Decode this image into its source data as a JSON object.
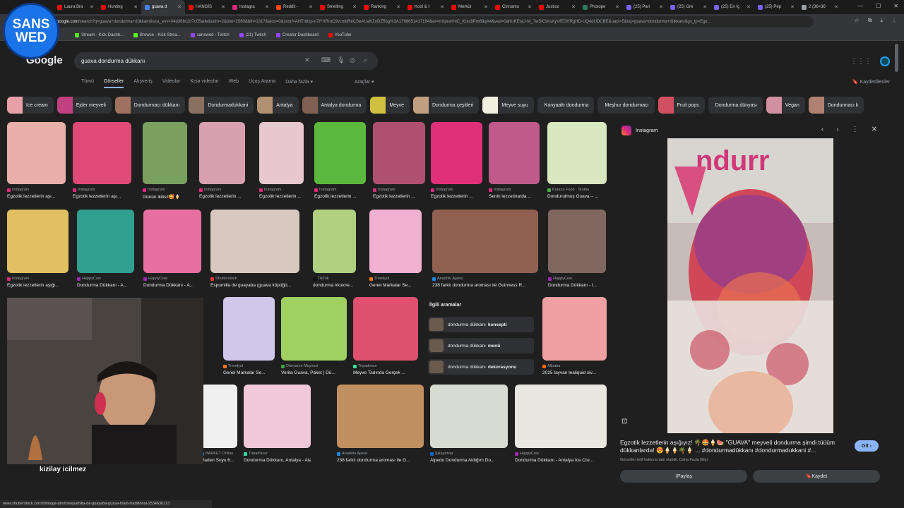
{
  "tabs": [
    {
      "label": "Laura Bra",
      "color": "#ff0000",
      "active": false
    },
    {
      "label": "Hunting",
      "color": "#ff0000",
      "active": false
    },
    {
      "label": "guava d",
      "color": "#4285f4",
      "active": true
    },
    {
      "label": "HANGİS",
      "color": "#ff0000",
      "active": false
    },
    {
      "label": "Instagra",
      "color": "#dd2a7b",
      "active": false
    },
    {
      "label": "Reddit -",
      "color": "#ff4500",
      "active": false
    },
    {
      "label": "Smelling",
      "color": "#ff0000",
      "active": false
    },
    {
      "label": "Ranking",
      "color": "#ff0000",
      "active": false
    },
    {
      "label": "Kool & t",
      "color": "#ff0000",
      "active": false
    },
    {
      "label": "Merkür",
      "color": "#ff0000",
      "active": false
    },
    {
      "label": "Cinnamo",
      "color": "#ff0000",
      "active": false
    },
    {
      "label": "Justice",
      "color": "#ff0000",
      "active": false
    },
    {
      "label": "Photope",
      "color": "#2d7a5c",
      "active": false
    },
    {
      "label": "(25) Pari",
      "color": "#7b61ff",
      "active": false
    },
    {
      "label": "(25) Gre",
      "color": "#7b61ff",
      "active": false
    },
    {
      "label": "(25) En İç",
      "color": "#7b61ff",
      "active": false
    },
    {
      "label": "(25) Pep",
      "color": "#7b61ff",
      "active": false
    },
    {
      "label": "2 (36×36",
      "color": "#9aa0a6",
      "active": false
    }
  ],
  "address": {
    "host": "google.com",
    "path": "/search?q=guava+dondurma+dükkanı&sca_esv=04d368c2d7c05ade&udm=2&biw=2560&bih=1317&aico=0&sxsrf=AHTn8zp-n7lYXRmC9vcmbReCSeAUaKZoDZ5bg%3A1768651417194&ei=mXpraYnlC_Krxc8Pm68qA4&ved=0ahUKEwjJ-M_7wSKSAsXyVfEDHRgHD-UQ4dUDCBE&uact=5&oq=guava+dondurma+dükkanı&gs_lp=Egx..."
  },
  "bookmarks": [
    {
      "label": "Stream - Kick Dashb...",
      "color": "#53fc18"
    },
    {
      "label": "Browse - Kick Strea...",
      "color": "#53fc18"
    },
    {
      "label": "sanswed - Twitch",
      "color": "#9146ff"
    },
    {
      "label": "(21) Twitch",
      "color": "#9146ff"
    },
    {
      "label": "Creator Dashboard",
      "color": "#9146ff"
    },
    {
      "label": "YouTube",
      "color": "#ff0000"
    }
  ],
  "stream_logo": {
    "line1": "SANS",
    "line2": "WED"
  },
  "google": {
    "logo": "Google",
    "query": "guava dondurma dükkanı",
    "nav": [
      "Tümü",
      "Görseller",
      "Alışveriş",
      "Videolar",
      "Kısa videolar",
      "Web",
      "Uçuş Arama",
      "Daha fazla ▾"
    ],
    "tools": "Araçlar ▾",
    "saved": "Kaydedilenler"
  },
  "chips": [
    {
      "label": "Ice cream",
      "color": "#e8a0a8"
    },
    {
      "label": "Ejder meyveli",
      "color": "#c04080"
    },
    {
      "label": "Dondurmacı dükkanı",
      "color": "#a07060"
    },
    {
      "label": "Dondurmadukkani",
      "color": "#8a7060"
    },
    {
      "label": "Antalya",
      "color": "#b09070"
    },
    {
      "label": "Antalya dondurma",
      "color": "#806050"
    },
    {
      "label": "Meyve",
      "color": "#d0c040"
    },
    {
      "label": "Dondurma çeşitleri",
      "color": "#c0a080"
    },
    {
      "label": "Meyve suyu",
      "color": "#f0f0e0"
    },
    {
      "label": "Konyaaltı dondurma",
      "color": ""
    },
    {
      "label": "Meşhur dondurmacı",
      "color": ""
    },
    {
      "label": "Fruit pops",
      "color": "#d05060"
    },
    {
      "label": "Dondurma dünyası",
      "color": ""
    },
    {
      "label": "Vegan",
      "color": "#d090a0"
    },
    {
      "label": "Dondurmacı k",
      "color": "#b08070"
    }
  ],
  "results_row1": [
    {
      "src": "Instagram",
      "cap": "Egzotik lezzetlerin aşı...",
      "color": "#e8b0a8",
      "srccolor": "#dd2a7b"
    },
    {
      "src": "Instagram",
      "cap": "Egzotik lezzetlerin aşı...",
      "color": "#e04a78",
      "srccolor": "#dd2a7b"
    },
    {
      "src": "Instagram",
      "cap": "Günün ikilisi!🥰🍦",
      "color": "#7aa060",
      "srccolor": "#dd2a7b"
    },
    {
      "src": "Instagram",
      "cap": "Egzotik lezzetlerin ...",
      "color": "#d8a0b0",
      "srccolor": "#dd2a7b"
    },
    {
      "src": "Instagram",
      "cap": "Egzotik lezzetlerin ...",
      "color": "#e8c8d0",
      "srccolor": "#dd2a7b"
    },
    {
      "src": "Instagram",
      "cap": "Egzotik lezzetlerin ...",
      "color": "#5cb83c",
      "srccolor": "#dd2a7b"
    },
    {
      "src": "Instagram",
      "cap": "Egzotik lezzetlerin ...",
      "color": "#b05070",
      "srccolor": "#dd2a7b"
    },
    {
      "src": "Instagram",
      "cap": "Egzotik lezzetlerin ...",
      "color": "#e0307a",
      "srccolor": "#dd2a7b"
    },
    {
      "src": "Instagram",
      "cap": "Senin lezzetinarda ...",
      "color": "#c05a8a",
      "srccolor": "#dd2a7b"
    },
    {
      "src": "Karaca Food · Stokta",
      "cap": "Dondurulmuş Guava – ...",
      "color": "#d8e8c0",
      "srccolor": "#4caf50"
    }
  ],
  "results_row2": [
    {
      "src": "Instagram",
      "cap": "Egzotik lezzetlerin aşığı...",
      "color": "#e0c060",
      "srccolor": "#dd2a7b"
    },
    {
      "src": "HappyCow",
      "cap": "Dondurma Dükkanı - A...",
      "color": "#30a090",
      "srccolor": "#9c27b0"
    },
    {
      "src": "HappyCow",
      "cap": "Dondurma Dükkanı - A...",
      "color": "#e870a0",
      "srccolor": "#9c27b0"
    },
    {
      "src": "Shutterstock",
      "cap": "Espumilla de guayaba (guava köpüğü...",
      "color": "#d8c8c0",
      "srccolor": "#e53935"
    },
    {
      "src": "TikTok",
      "cap": "dondurma #icecre...",
      "color": "#b0d080",
      "srccolor": "#111"
    },
    {
      "src": "Trendyol",
      "cap": "Genel Markalar Se...",
      "color": "#f0b0d0",
      "srccolor": "#f27a1a"
    },
    {
      "src": "Anadolu Ajansı",
      "cap": "238 farklı dondurma aroması ile Guinness R...",
      "color": "#906050",
      "srccolor": "#1e88e5"
    },
    {
      "src": "HappyCow",
      "cap": "Dondurma Dükkanı - I...",
      "color": "#806860",
      "srccolor": "#9c27b0"
    }
  ],
  "results_row3": [
    {
      "src": "Trendyol",
      "cap": "Genel Markalar Se...",
      "color": "#d0c8e8",
      "srccolor": "#f27a1a"
    },
    {
      "src": "Dünyanın Meyvesi",
      "cap": "Verita Guava, Paket | Dü...",
      "color": "#a0d060",
      "srccolor": "#43a047"
    },
    {
      "src": "Tripadvisor",
      "cap": "Meyve Tadında Gerçek ...",
      "color": "#e05070",
      "srccolor": "#34e0a1"
    },
    {
      "src": "Alibaba",
      "cap": "2025 tayvan lealiquid siv...",
      "color": "#f0a0a0",
      "srccolor": "#ff6a00"
    }
  ],
  "results_row4": [
    {
      "src": "BARKET Online",
      "cap": "Maden Suyu 6...",
      "color": "#f0f0f0",
      "srccolor": "#1e88e5"
    },
    {
      "src": "Tripadvisor",
      "cap": "Dondurma Dükkanı, Antalya - Atat...",
      "color": "#f0c8d8",
      "srccolor": "#34e0a1"
    },
    {
      "src": "Anadolu Ajansı",
      "cap": "238 farklı dondurma aroması ile G...",
      "color": "#c09060",
      "srccolor": "#1e88e5"
    },
    {
      "src": "Şikayetvar",
      "cap": "Alpedo Dondurma Aldığım Do...",
      "color": "#d8dcd0",
      "srccolor": "#1565c0"
    },
    {
      "src": "HappyCow",
      "cap": "Dondurma Dükkanı - Antalya Ice Cre...",
      "color": "#e8e8e0",
      "srccolor": "#9c27b0"
    }
  ],
  "related": {
    "header": "İlgili aramalar",
    "items": [
      {
        "prefix": "dondurma dükkanı ",
        "bold": "konsepti"
      },
      {
        "prefix": "dondurma dükkanı ",
        "bold": "menü"
      },
      {
        "prefix": "dondurma dükkanı ",
        "bold": "dekorasyonu"
      }
    ]
  },
  "panel": {
    "source": "Instagram",
    "title": "Egzotik lezzetlerin aşığıyız! 🌴🤩🍦🍉 \"GUAVA\" meyveli dondurma şimdi tüüüm dükkanlarda! 😍🍦🍦🌴🍦 ... #dondurmadükkanı #dondurmadukkani #...",
    "note": "Görseller telif hakkına tabi olabilir. Daha Fazla Bilgi",
    "visit": "Git ›",
    "share": "Paylaş",
    "save": "Kaydet"
  },
  "overlay": {
    "text": "kizilay icilmez"
  },
  "status_url": "www.shutterstock.com/tr/image-photo/espumilla-de-guayaba-guava-foam-traditional-2534636123"
}
